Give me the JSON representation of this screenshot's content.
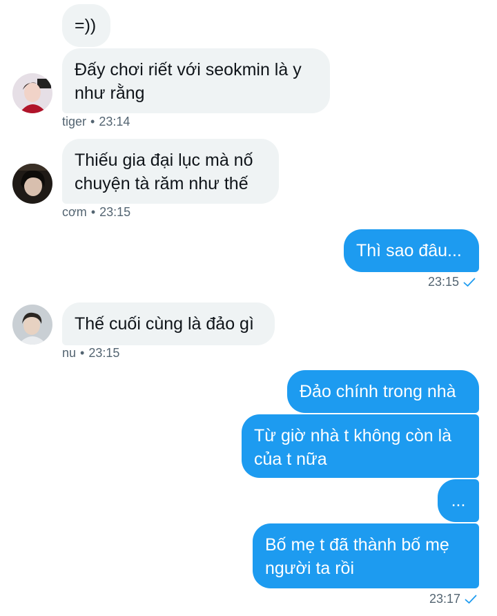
{
  "messages": {
    "m1": {
      "text": "=))"
    },
    "m2": {
      "line1": "Đấy chơi riết với seokmin là y",
      "line2": "như rằng",
      "sender": "tiger",
      "time": "23:14"
    },
    "m3": {
      "line1": "Thiếu gia đại lục mà nố",
      "line2": "chuyện tà răm như thế",
      "sender": "cơm",
      "time": "23:15"
    },
    "m4": {
      "text": "Thì sao đâu...",
      "time": "23:15"
    },
    "m5": {
      "text": "Thế cuối cùng là đảo gì",
      "sender": "nu",
      "time": "23:15"
    },
    "m6": {
      "text": "Đảo chính trong nhà"
    },
    "m7": {
      "line1": "Từ giờ nhà t không còn là",
      "line2": "của t nữa"
    },
    "m8": {
      "text": "..."
    },
    "m9": {
      "line1": "Bố mẹ t đã thành bố mẹ",
      "line2": "người ta rồi",
      "time": "23:17"
    }
  },
  "meta_separator": "•",
  "colors": {
    "incoming_bubble": "#eff3f4",
    "outgoing_bubble": "#1d9bf0",
    "meta_text": "#536471",
    "read_check": "#1d9bf0"
  },
  "icons": {
    "read_receipt": "check-icon",
    "avatar": "avatar-photo"
  }
}
